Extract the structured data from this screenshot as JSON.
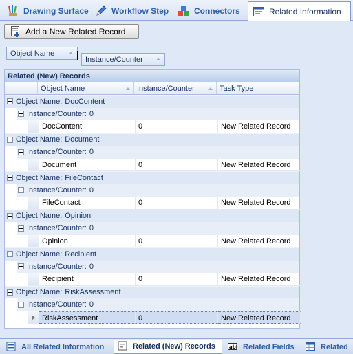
{
  "top_tabs": [
    {
      "label": "Drawing Surface",
      "icon": "paintbrushes-icon"
    },
    {
      "label": "Workflow Step",
      "icon": "pencil-icon"
    },
    {
      "label": "Connectors",
      "icon": "blocks-icon"
    },
    {
      "label": "Related Information",
      "icon": "window-icon"
    }
  ],
  "toolbar": {
    "add_label": "Add a New Related Record"
  },
  "group_by": {
    "chip1": "Object Name",
    "chip2": "Instance/Counter"
  },
  "grid": {
    "title": "Related (New) Records",
    "columns": [
      "Object Name",
      "Instance/Counter",
      "Task Type"
    ],
    "group_prefix": "Object Name:",
    "subgroup_prefix": "Instance/Counter:",
    "groups": [
      {
        "name": "DocContent",
        "counter": "0",
        "row": [
          "DocContent",
          "0",
          "New Related Record"
        ]
      },
      {
        "name": "Document",
        "counter": "0",
        "row": [
          "Document",
          "0",
          "New Related Record"
        ]
      },
      {
        "name": "FileContact",
        "counter": "0",
        "row": [
          "FileContact",
          "0",
          "New Related Record"
        ]
      },
      {
        "name": "Opinion",
        "counter": "0",
        "row": [
          "Opinion",
          "0",
          "New Related Record"
        ]
      },
      {
        "name": "Recipient",
        "counter": "0",
        "row": [
          "Recipient",
          "0",
          "New Related Record"
        ]
      },
      {
        "name": "RiskAssessment",
        "counter": "0",
        "row": [
          "RiskAssessment",
          "0",
          "New Related Record"
        ]
      }
    ]
  },
  "bottom_tabs": [
    {
      "label": "All Related Information"
    },
    {
      "label": "Related (New) Records"
    },
    {
      "label": "Related Fields"
    },
    {
      "label": "Related"
    }
  ],
  "colors": {
    "accent": "#2f5fa8",
    "header_bg": "#dfe8f6",
    "selected_row": "#cfdcf1"
  }
}
